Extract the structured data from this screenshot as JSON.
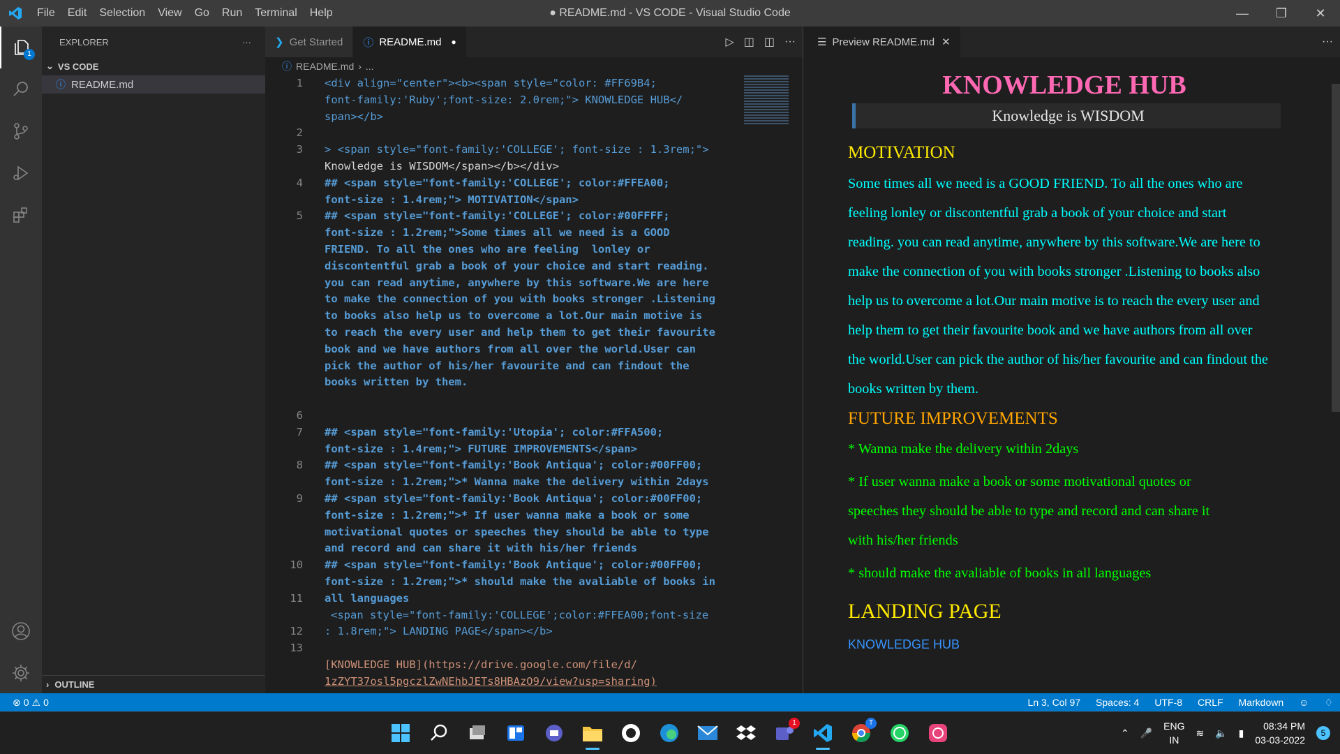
{
  "window": {
    "title": "● README.md - VS CODE - Visual Studio Code"
  },
  "menu": [
    "File",
    "Edit",
    "Selection",
    "View",
    "Go",
    "Run",
    "Terminal",
    "Help"
  ],
  "sidebar": {
    "header": "EXPLORER",
    "section": "VS CODE",
    "file": "README.md",
    "outline": "OUTLINE",
    "explorer_badge": "1"
  },
  "editor": {
    "tabs": [
      {
        "label": "Get Started",
        "icon": "vscode-icon"
      },
      {
        "label": "README.md",
        "icon": "info-icon",
        "dirty": true
      }
    ],
    "breadcrumb": [
      "README.md",
      "..."
    ],
    "line_numbers": [
      "1",
      "2",
      "3",
      "4",
      "5",
      "6",
      "7",
      "8",
      "9",
      "10",
      "11",
      "12",
      "13"
    ]
  },
  "code_lines": [
    "<div align=\"center\"><b><span style=\"color: #FF69B4;",
    "font-family:'Ruby';font-size: 2.0rem;\"> KNOWLEDGE HUB</",
    "span></b>",
    "> <span style=\"font-family:'COLLEGE'; font-size : 1.3rem;\">",
    "Knowledge is WISDOM</span></b></div>",
    "## <span style=\"font-family:'COLLEGE'; color:#FFEA00;",
    "font-size : 1.4rem;\"> MOTIVATION</span>",
    "## <span style=\"font-family:'COLLEGE'; color:#00FFFF;",
    "font-size : 1.2rem;\">Some times all we need is a GOOD",
    "FRIEND. To all the ones who are feeling  lonley or",
    "discontentful grab a book of your choice and start reading.",
    "you can read anytime, anywhere by this software.We are here",
    "to make the connection of you with books stronger .Listening",
    "to books also help us to overcome a lot.Our main motive is",
    "to reach the every user and help them to get their favourite",
    "book and we have authors from all over the world.User can",
    "pick the author of his/her favourite and can findout the",
    "books written by them.",
    "## <span style=\"font-family:'Utopia'; color:#FFA500;",
    "font-size : 1.4rem;\"> FUTURE IMPROVEMENTS</span>",
    "## <span style=\"font-family:'Book Antiqua'; color:#00FF00;",
    "font-size : 1.2rem;\">* Wanna make the delivery within 2days",
    "## <span style=\"font-family:'Book Antiqua'; color:#00FF00;",
    "font-size : 1.2rem;\">* If user wanna make a book or some",
    "motivational quotes or speeches they should be able to type",
    "and record and can share it with his/her friends",
    "## <span style=\"font-family:'Book Antique'; color:#00FF00;",
    "font-size : 1.2rem;\">* should make the avaliable of books in",
    "all languages",
    "<span style=\"font-family:'COLLEGE';color:#FFEA00;font-size",
    ": 1.8rem;\"> LANDING PAGE</span></b>",
    "[KNOWLEDGE HUB](https://drive.google.com/file/d/",
    "1zZYT37osl5pgczlZwNEhbJETs8HBAzO9/view?usp=sharing)"
  ],
  "preview": {
    "tab_label": "Preview README.md",
    "title": "KNOWLEDGE HUB",
    "quote": "Knowledge is WISDOM",
    "motivation_heading": "MOTIVATION",
    "motivation_lines": [
      "Some times all we need is a GOOD FRIEND. To all the ones who are",
      "feeling lonley or discontentful grab a book of your choice and start",
      "reading. you can read anytime, anywhere by this software.We are here to",
      "make the connection of you with books stronger .Listening to books also",
      "help us to overcome a lot.Our main motive is to reach the every user and",
      "help them to get their favourite book and we have authors from all over",
      "the world.User can pick the author of his/her favourite and can findout the",
      "books written by them."
    ],
    "future_heading": "FUTURE IMPROVEMENTS",
    "item1": "* Wanna make the delivery within 2days",
    "item2_lines": [
      "* If user wanna make a book or some motivational quotes or",
      "speeches they should be able to type and record and can share it",
      "with his/her friends"
    ],
    "item3": "* should make the avaliable of books in all languages",
    "landing_heading": "LANDING PAGE",
    "link_text": "KNOWLEDGE HUB"
  },
  "statusbar": {
    "errors": "0",
    "warnings": "0",
    "position": "Ln 3, Col 97",
    "spaces": "Spaces: 4",
    "encoding": "UTF-8",
    "eol": "CRLF",
    "language": "Markdown"
  },
  "taskbar": {
    "lang1": "ENG",
    "lang2": "IN",
    "time": "08:34 PM",
    "date": "03-03-2022",
    "notif_count": "5",
    "teams_badge": "1",
    "chrome_badge": "T"
  },
  "colors": {
    "accent": "#007acc",
    "pink": "#FF69B4",
    "yellow": "#FFEA00",
    "cyan": "#00FFFF",
    "orange": "#FFA500",
    "green": "#00FF00"
  }
}
